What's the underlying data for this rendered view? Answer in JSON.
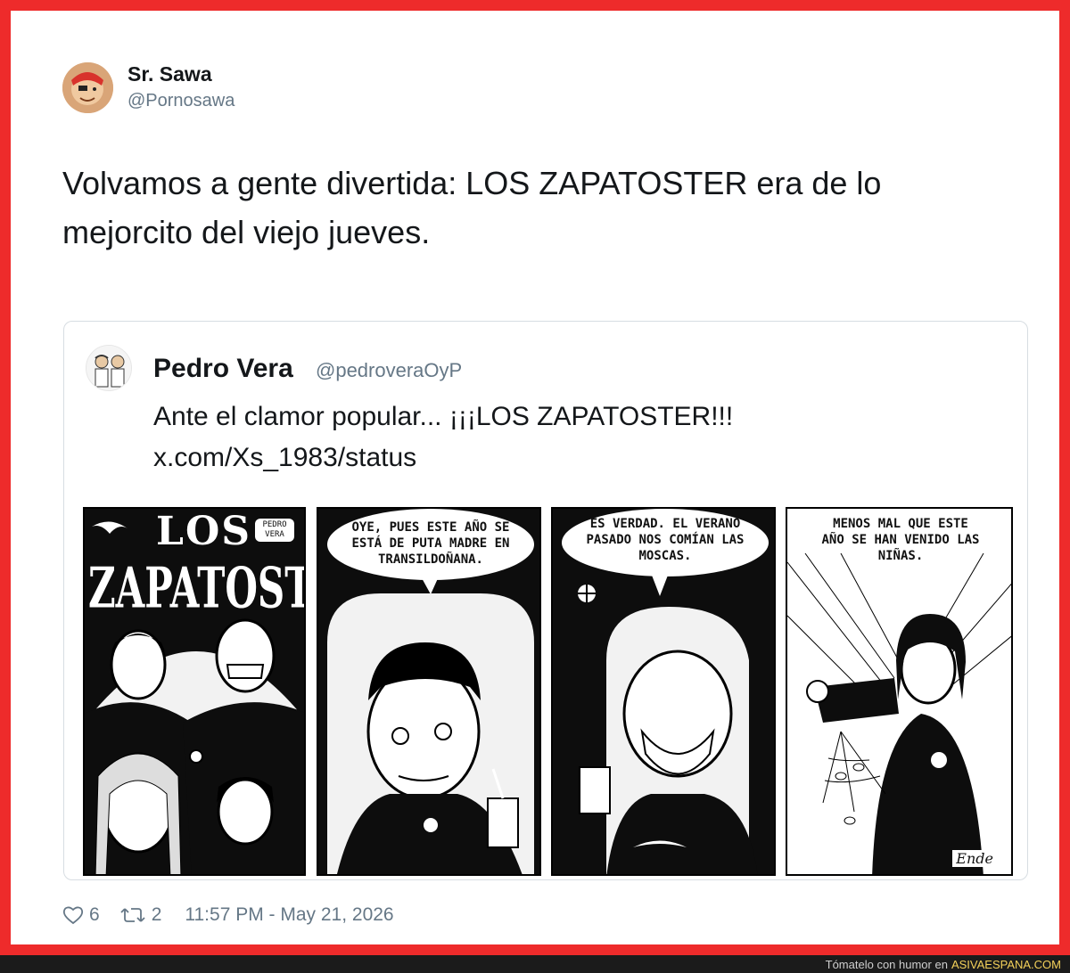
{
  "tweet": {
    "author_name": "Sr. Sawa",
    "author_handle": "@Pornosawa",
    "text_line1": "Volvamos a gente divertida: LOS ZAPATOSTER era de lo",
    "text_line2": "mejorcito del viejo jueves.",
    "likes": "6",
    "retweets": "2",
    "timestamp": "11:57 PM - May 21, 2026"
  },
  "quote": {
    "author_name": "Pedro Vera",
    "author_handle": "@pedroveraOyP",
    "text": "Ante el clamor popular... ¡¡¡LOS ZAPATOSTER!!!",
    "link": "x.com/Xs_1983/status"
  },
  "comic": {
    "panel1": {
      "title_top": "LOS",
      "title_main": "ZAPATOSTER",
      "author_tag_line1": "PEDRO",
      "author_tag_line2": "VERA"
    },
    "panel2": {
      "bubble_line1": "OYE, PUES ESTE AÑO SE",
      "bubble_line2": "ESTÁ DE PUTA MADRE EN",
      "bubble_line3": "TRANSILDOÑANA."
    },
    "panel3": {
      "bubble_line1": "ES VERDAD. EL VERANO",
      "bubble_line2": "PASADO NOS COMÍAN LAS",
      "bubble_line3": "MOSCAS."
    },
    "panel4": {
      "bubble_line1": "MENOS MAL QUE ESTE",
      "bubble_line2": "AÑO SE HAN VENIDO LAS",
      "bubble_line3": "NIÑAS.",
      "signature": "Ende"
    }
  },
  "footer": {
    "prefix": "Tómatelo con humor en",
    "site": "ASIVAESPANA.COM"
  },
  "icons": {
    "like": "heart-icon",
    "retweet": "retweet-icon"
  },
  "colors": {
    "frame_border": "#ee2b2b",
    "text_primary": "#14171a",
    "text_secondary": "#657786",
    "footer_bg": "#1b1b1b",
    "footer_site": "#f4d15a"
  }
}
